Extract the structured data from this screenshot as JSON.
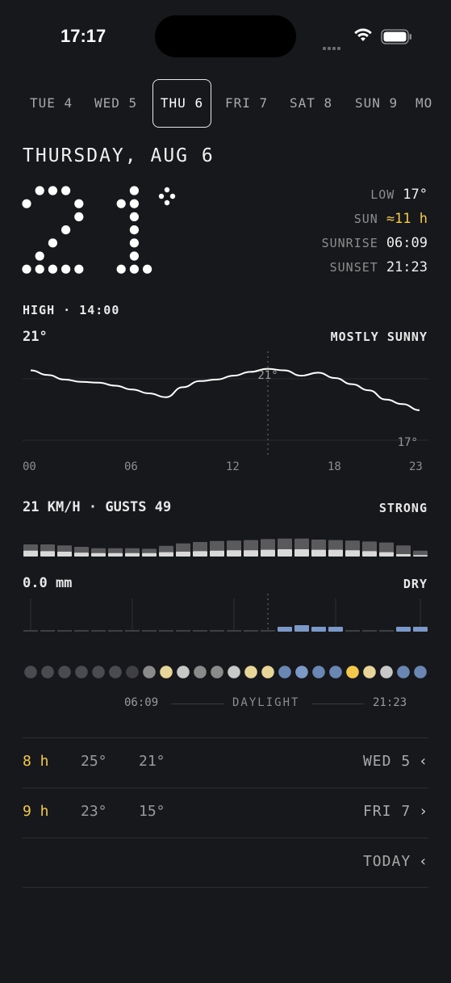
{
  "status_bar": {
    "time": "17:17"
  },
  "days": [
    {
      "label": "TUE 4",
      "active": false
    },
    {
      "label": "WED 5",
      "active": false
    },
    {
      "label": "THU 6",
      "active": true
    },
    {
      "label": "FRI 7",
      "active": false
    },
    {
      "label": "SAT 8",
      "active": false
    },
    {
      "label": "SUN 9",
      "active": false
    },
    {
      "label": "MO",
      "active": false
    }
  ],
  "header": {
    "date_title": "THURSDAY, AUG 6",
    "current_temp": 21
  },
  "stats": {
    "low_label": "LOW",
    "low_value": "17°",
    "sun_label": "SUN",
    "sun_value": "≈11 h",
    "sunrise_label": "SUNRISE",
    "sunrise_value": "06:09",
    "sunset_label": "SUNSET",
    "sunset_value": "21:23"
  },
  "temperature": {
    "high_label": "HIGH · 14:00",
    "current": "21°",
    "condition": "MOSTLY SUNNY",
    "max_label": "21°",
    "min_label": "17°",
    "hourly": [
      20.5,
      20.2,
      19.9,
      19.75,
      19.7,
      19.5,
      19.25,
      19.0,
      18.75,
      19.4,
      19.8,
      19.9,
      20.15,
      20.4,
      20.6,
      20.5,
      20.15,
      20.35,
      20.0,
      19.6,
      19.2,
      18.6,
      18.3,
      17.9
    ],
    "x_ticks": [
      "00",
      "06",
      "12",
      "18",
      "23"
    ],
    "colors": {
      "line": "#ffffff",
      "grid": "#2a2b2f",
      "marker": "#555555"
    }
  },
  "wind": {
    "label": "21 KM/H · GUSTS 49",
    "level": "STRONG",
    "gusts": [
      25,
      25,
      23,
      20,
      17,
      17,
      17,
      16,
      22,
      27,
      30,
      32,
      33,
      34,
      36,
      37,
      37,
      35,
      34,
      33,
      31,
      29,
      23,
      12
    ],
    "speeds": [
      12,
      11,
      10,
      8,
      7,
      7,
      7,
      7,
      9,
      10,
      11,
      12,
      13,
      13,
      14,
      15,
      15,
      14,
      14,
      13,
      11,
      9,
      5,
      3
    ],
    "colors": {
      "gust": "#5a5a5d",
      "speed": "#d9d9d9"
    }
  },
  "precipitation": {
    "label": "0.0 mm",
    "status": "DRY",
    "hourly": [
      0,
      0,
      0,
      0,
      0,
      0,
      0,
      0,
      0,
      0,
      0,
      0,
      0,
      0,
      0,
      0.3,
      0.5,
      0.3,
      0.3,
      0,
      0,
      0,
      0.3,
      0.3
    ],
    "colors": {
      "dry": "#3e3f43",
      "wet": "#7b98c7"
    }
  },
  "sky_dots": {
    "colors": [
      "#4a4a50",
      "#4a4a50",
      "#4a4a50",
      "#4a4a50",
      "#4a4a50",
      "#4a4a50",
      "#3f3f44",
      "#8a8a8a",
      "#e8d59a",
      "#c8c8c8",
      "#8a8a8a",
      "#8a8a8a",
      "#c8c8c8",
      "#e8d59a",
      "#e8d59a",
      "#6a86b3",
      "#7b98c7",
      "#6a86b3",
      "#6a86b3",
      "#f2c94c",
      "#e8d59a",
      "#c8c8c8",
      "#6a86b3",
      "#6a86b3"
    ]
  },
  "daylight": {
    "start": "06:09",
    "label": "DAYLIGHT",
    "end": "21:23"
  },
  "comparisons": [
    {
      "hours": "8 h",
      "high": "25°",
      "low": "21°",
      "day": "WED 5",
      "chevron": "‹"
    },
    {
      "hours": "9 h",
      "high": "23°",
      "low": "15°",
      "day": "FRI 7",
      "chevron": "›"
    },
    {
      "hours": "",
      "high": "",
      "low": "",
      "day": "TODAY",
      "chevron": "‹"
    }
  ]
}
